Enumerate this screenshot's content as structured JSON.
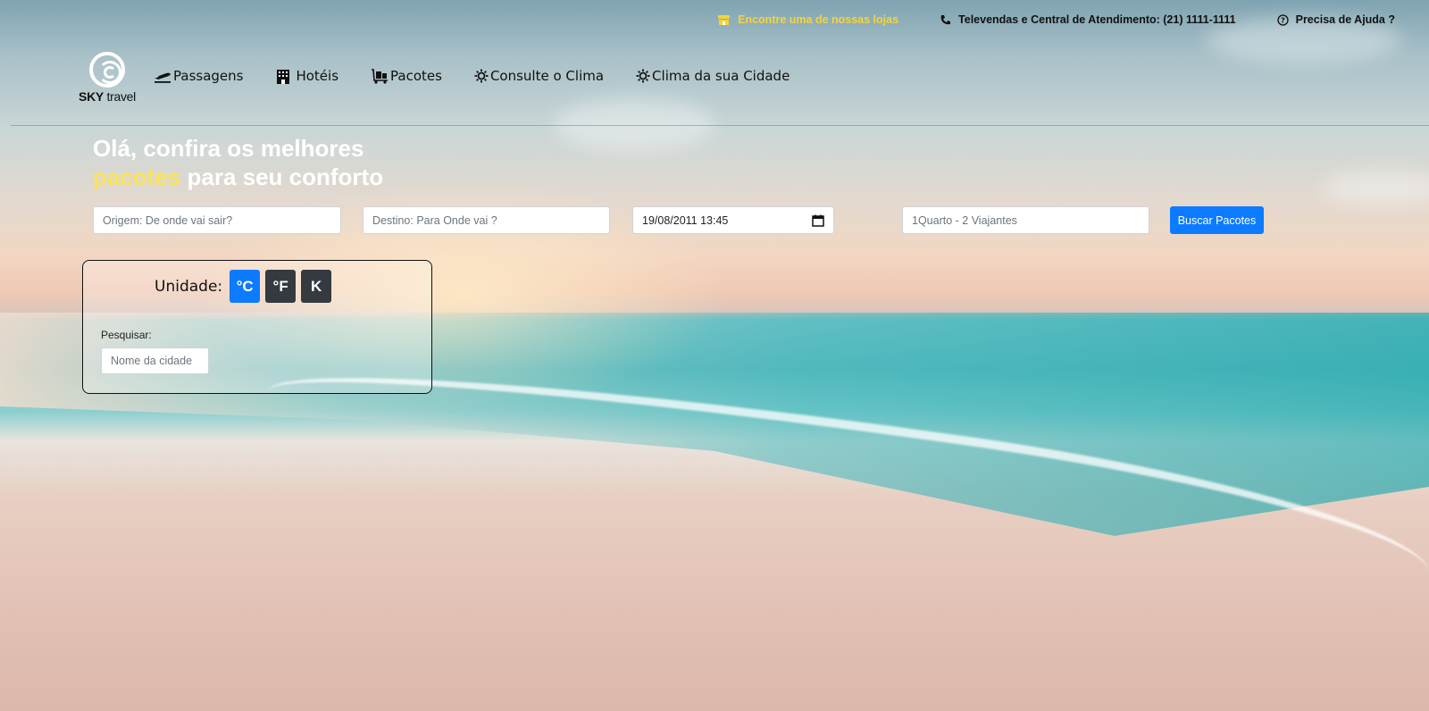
{
  "topbar": {
    "store_label": "Encontre uma de nossas lojas",
    "phone_label": "Televendas e Central de Atendimento: (21) 1111-1111",
    "help_label": "Precisa de Ajuda ?"
  },
  "brand": {
    "name_bold": "SKY",
    "name_light": "travel"
  },
  "nav": {
    "items": [
      {
        "label": "Passagens",
        "icon": "airplane-icon"
      },
      {
        "label": "Hotéis",
        "icon": "hotel-building-icon"
      },
      {
        "label": "Pacotes",
        "icon": "luggage-cart-icon"
      },
      {
        "label": "Consulte o Clima",
        "icon": "sun-icon"
      },
      {
        "label": "Clima da sua Cidade",
        "icon": "sun-icon"
      }
    ]
  },
  "hero": {
    "line1": "Olá, confira os melhores",
    "line2_accent": "pacotes",
    "line2_rest": " para seu conforto"
  },
  "search": {
    "origin_placeholder": "Origem: De onde vai sair?",
    "destination_placeholder": "Destino: Para Onde vai ?",
    "datetime_value": "19/08/2011 13:45",
    "rooms_placeholder": "1Quarto - 2 Viajantes",
    "submit_label": "Buscar Pacotes"
  },
  "weather": {
    "unit_label": "Unidade:",
    "units": [
      "°C",
      "°F",
      "K"
    ],
    "selected_unit": "°C",
    "search_label": "Pesquisar:",
    "city_placeholder": "Nome da cidade"
  },
  "colors": {
    "accent_yellow": "#f9e45a",
    "primary_blue": "#0d7bff",
    "dark_button": "#343a40"
  }
}
